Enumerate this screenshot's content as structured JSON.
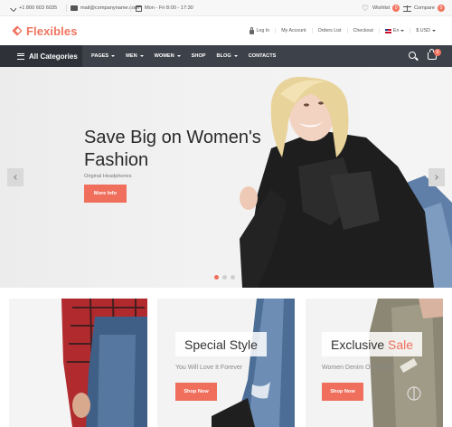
{
  "topbar": {
    "phone": "+1 800 603 6035",
    "email": "mail@companyname.com",
    "hours": "Mon - Fri 8:00 - 17:30",
    "wishlist_label": "Wishlist",
    "wishlist_count": "0",
    "compare_label": "Compare",
    "compare_count": "0"
  },
  "header": {
    "logo": "Flexibles",
    "links": {
      "login": "Log In",
      "account": "My Account",
      "orders": "Orders List",
      "checkout": "Checkout",
      "language": "En",
      "currency": "$ USD"
    }
  },
  "nav": {
    "all_categories": "All Categories",
    "items": [
      {
        "label": "PAGES",
        "dropdown": true
      },
      {
        "label": "MEN",
        "dropdown": true
      },
      {
        "label": "WOMEN",
        "dropdown": true
      },
      {
        "label": "SHOP",
        "dropdown": false
      },
      {
        "label": "BLOG",
        "dropdown": true
      },
      {
        "label": "CONTACTS",
        "dropdown": false
      }
    ],
    "cart_count": "0"
  },
  "hero": {
    "title_line1": "Save Big on Women's",
    "title_line2": "Fashion",
    "subtitle": "Original Headphones",
    "button": "More Info",
    "active_slide": 1,
    "slide_count": 3
  },
  "banners": [
    {
      "title": "",
      "subtitle": "",
      "button": ""
    },
    {
      "title": "Special Style",
      "subtitle": "You Will Love It Forever",
      "button": "Shop Now"
    },
    {
      "title_plain": "Exclusive",
      "title_accent": "Sale",
      "subtitle": "Women Denim Outerwear",
      "button": "Shop Now"
    }
  ],
  "colors": {
    "accent": "#ef6f5c",
    "nav_bg": "#3d4149",
    "nav_dark": "#2e3138"
  }
}
